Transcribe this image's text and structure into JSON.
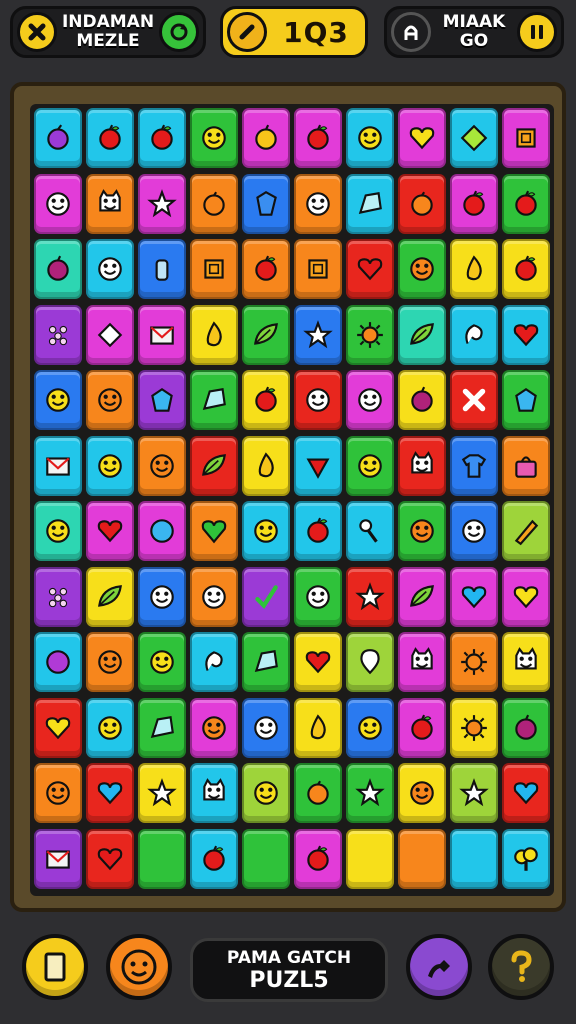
{
  "top_bar": {
    "left_pill": {
      "line1": "INDAMAN",
      "line2": "MEZLE"
    },
    "score": "1Q3",
    "right_pill": {
      "line1": "MIAAK",
      "line2": "GO"
    }
  },
  "bottom_bar": {
    "title_line1": "PAMA GATCH",
    "title_line2": "PUZL5"
  },
  "colors": {
    "cyan": "#22c6ea",
    "magenta": "#e23cd8",
    "purple": "#9b3ad6",
    "green": "#2fc23a",
    "lime": "#9ed43a",
    "yellow": "#f7df1a",
    "orange": "#f7861c",
    "red": "#e8261e",
    "blue": "#2a7af0",
    "pink": "#f05ab0",
    "teal": "#2dd6b2"
  },
  "board": {
    "columns": 10,
    "rows": 12,
    "tiles": [
      [
        "cyan:purple-fruit",
        "cyan:apple",
        "cyan:apple",
        "green:smiley",
        "magenta:yellow-apple",
        "magenta:apple",
        "cyan:smiley",
        "magenta:yellow-heart",
        "cyan:green-diamond",
        "magenta:square"
      ],
      [
        "magenta:face",
        "orange:cat",
        "magenta:star",
        "orange:orange",
        "blue:gem",
        "orange:face",
        "cyan:crystal",
        "red:orange",
        "magenta:apple",
        "green:apple"
      ],
      [
        "teal:plum",
        "cyan:face",
        "blue:bottle",
        "orange:square",
        "orange:apple",
        "orange:square",
        "red:heart",
        "green:orange-face",
        "yellow:drop",
        "yellow:apple"
      ],
      [
        "purple:dots",
        "magenta:diamond",
        "magenta:envelope",
        "yellow:drop",
        "green:leaf",
        "blue:star",
        "green:sun",
        "teal:leaf",
        "cyan:shell",
        "cyan:heart"
      ],
      [
        "blue:smiley",
        "orange:orange-face",
        "purple:blue-gem",
        "green:crystal",
        "yellow:apple",
        "red:face",
        "magenta:face",
        "yellow:plum",
        "red:cross",
        "green:blue-gem"
      ],
      [
        "cyan:envelope",
        "cyan:smiley",
        "orange:orange-face",
        "red:leaf",
        "yellow:drop",
        "cyan:red-gem",
        "green:smiley",
        "red:cat",
        "blue:shirt",
        "orange:bag"
      ],
      [
        "teal:smiley",
        "magenta:heart",
        "magenta:blue-ball",
        "orange:heart-shield",
        "cyan:smiley",
        "cyan:apple",
        "cyan:key",
        "green:orange-face",
        "blue:face",
        "lime:pencil"
      ],
      [
        "purple:dots",
        "yellow:leaf",
        "blue:face",
        "orange:face",
        "purple:check",
        "green:face",
        "red:star",
        "magenta:leaf",
        "magenta:blue-heart",
        "magenta:yellow-heart"
      ],
      [
        "cyan:purple-ball",
        "orange:orange-face",
        "green:smiley",
        "cyan:shell",
        "green:crystal",
        "yellow:heart",
        "lime:pin",
        "magenta:cat",
        "orange:sun",
        "yellow:cat"
      ],
      [
        "red:yellow-heart",
        "cyan:smiley",
        "green:crystal",
        "magenta:orange-face",
        "blue:face",
        "yellow:drop",
        "blue:smiley",
        "magenta:apple",
        "yellow:sun",
        "green:plum"
      ],
      [
        "orange:orange-face",
        "red:blue-heart",
        "yellow:star",
        "cyan:cat",
        "lime:smiley",
        "green:orange",
        "green:star",
        "yellow:orange-face",
        "lime:star",
        "red:blue-heart"
      ],
      [
        "purple:envelope",
        "red:heart",
        "green:none",
        "cyan:apple",
        "green:none",
        "magenta:apple",
        "yellow:none",
        "orange:none",
        "cyan:none",
        "cyan:bush"
      ]
    ]
  }
}
